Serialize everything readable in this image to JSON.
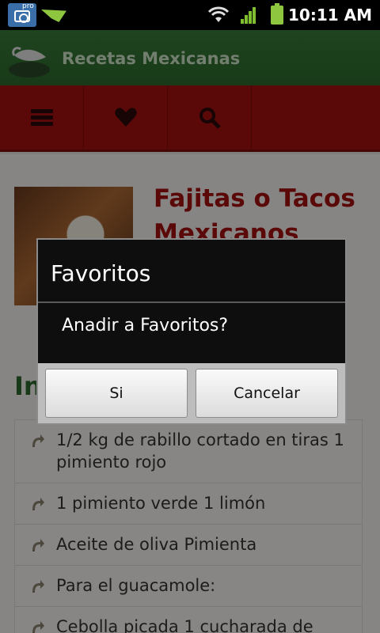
{
  "status_bar": {
    "time": "10:11 AM",
    "camera_badge": "pro",
    "icons": [
      "camera-pro-icon",
      "android-notification-icon",
      "wifi-icon",
      "signal-icon",
      "battery-icon"
    ]
  },
  "app": {
    "title": "Recetas Mexicanas",
    "logo_icon": "chili-pepper-icon"
  },
  "toolbar": {
    "items": [
      {
        "name": "menu",
        "icon": "menu-icon"
      },
      {
        "name": "favorites",
        "icon": "heart-icon"
      },
      {
        "name": "search",
        "icon": "search-icon"
      }
    ]
  },
  "recipe": {
    "title": "Fajitas o Tacos Mexicanos",
    "rating_stars": "★★★★★",
    "section_title": "In",
    "ingredients": [
      "1/2 kg de rabillo cortado en tiras 1 pimiento rojo",
      "1 pimiento verde 1 limón",
      "Aceite de oliva Pimienta",
      "Para el guacamole:",
      "Cebolla picada 1 cucharada de"
    ]
  },
  "dialog": {
    "title": "Favoritos",
    "message": "Anadir a Favoritos?",
    "confirm_label": "Si",
    "cancel_label": "Cancelar"
  },
  "colors": {
    "header_green": "#2c6a2c",
    "toolbar_red": "#a40f0f",
    "title_red": "#a40f0f"
  }
}
